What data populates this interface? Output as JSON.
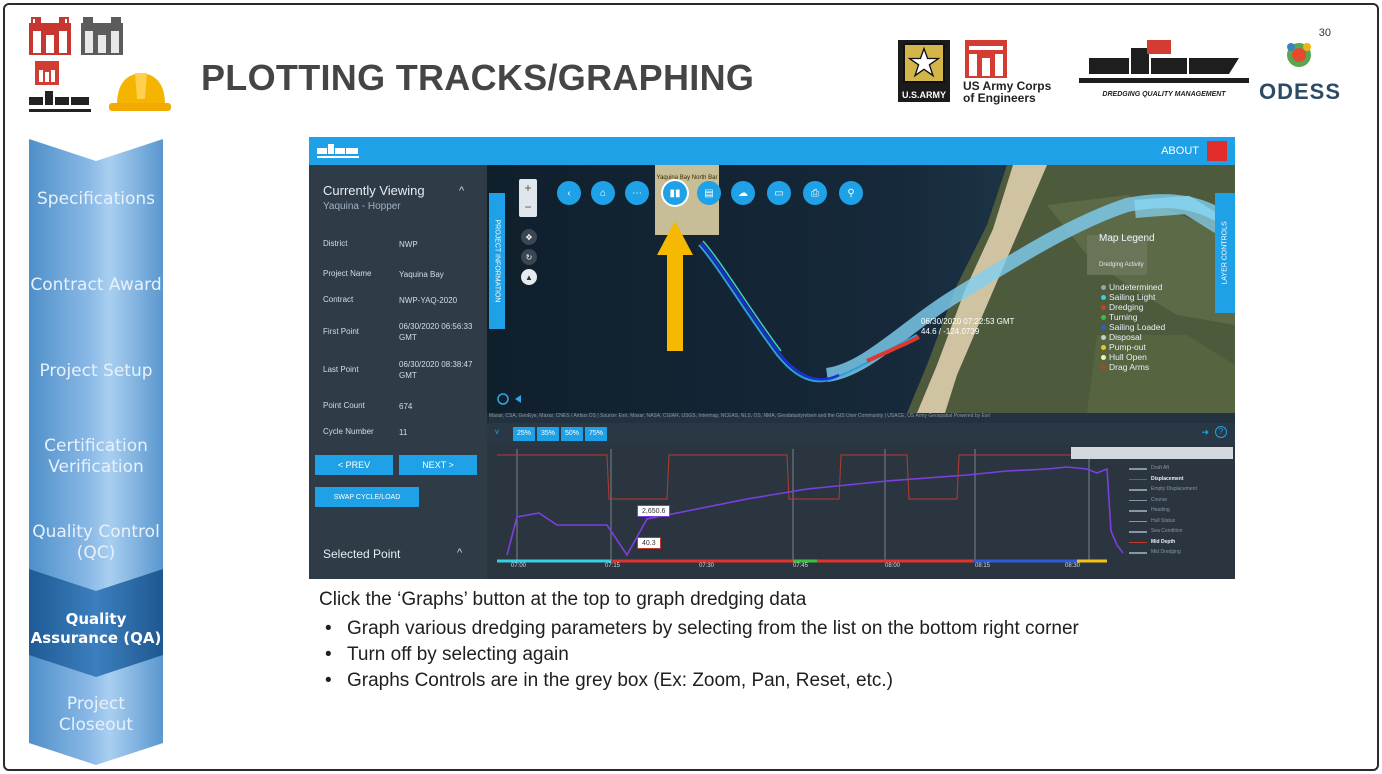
{
  "slide": {
    "number": "30",
    "title": "PLOTTING TRACKS/GRAPHING"
  },
  "logos": {
    "army_text": "U.S.ARMY",
    "usace_text_line1": "US Army Corps",
    "usace_text_line2": "of Engineers",
    "dqm_caption": "DREDGING QUALITY MANAGEMENT",
    "odess_text": "ODESS"
  },
  "nav": {
    "items": [
      {
        "label": "Specifications"
      },
      {
        "label": "Contract Award"
      },
      {
        "label": "Project Setup"
      },
      {
        "label": "Certification Verification"
      },
      {
        "label": "Quality Control (QC)"
      },
      {
        "label": "Quality Assurance (QA)",
        "active": true
      },
      {
        "label": "Project Closeout"
      }
    ]
  },
  "app": {
    "about": "ABOUT",
    "side_panel": {
      "title": "Currently Viewing",
      "subtitle": "Yaquina - Hopper",
      "rows": [
        {
          "key": "District",
          "value": "NWP"
        },
        {
          "key": "Project Name",
          "value": "Yaquina Bay"
        },
        {
          "key": "Contract",
          "value": "NWP-YAQ-2020"
        },
        {
          "key": "First Point",
          "value": "06/30/2020 06:56:33 GMT"
        },
        {
          "key": "Last Point",
          "value": "06/30/2020 08:38:47 GMT"
        },
        {
          "key": "Point Count",
          "value": "674"
        },
        {
          "key": "Cycle Number",
          "value": "11"
        }
      ],
      "prev": "< PREV",
      "next": "NEXT >",
      "swap": "SWAP CYCLE/LOAD",
      "selected_point": "Selected Point"
    },
    "project_tab": "PROJECT INFORMATION",
    "layer_tab": "LAYER CONTROLS",
    "map_label_top": "Yaquina Bay North Bar",
    "toolbar_icons": [
      "chevron-left-icon",
      "home-icon",
      "dots-icon",
      "graphs-icon",
      "document-icon",
      "cloud-download-icon",
      "ruler-icon",
      "print-icon",
      "location-pin-icon"
    ],
    "legend": {
      "title": "Map Legend",
      "subtitle": "Dredging Activity",
      "items": [
        {
          "label": "Undetermined",
          "color": "#9aa3ad"
        },
        {
          "label": "Sailing Light",
          "color": "#37d0e0"
        },
        {
          "label": "Dredging",
          "color": "#e0342c"
        },
        {
          "label": "Turning",
          "color": "#3fbf3f"
        },
        {
          "label": "Sailing Loaded",
          "color": "#2f5bd8"
        },
        {
          "label": "Disposal",
          "color": "#c9c9c9"
        },
        {
          "label": "Pump-out",
          "color": "#f2c318"
        },
        {
          "label": "Hull Open",
          "color": "#f4f4a0"
        },
        {
          "label": "Drag Arms",
          "color": "#c0392b"
        }
      ]
    },
    "hover_readout": {
      "line1": "06/30/2020 07:22:53 GMT",
      "line2": "44.6 / -124.0739"
    },
    "attribution": "Maxar, CSA, GeoEye, Maxar, CNES / Airbus DS | Source: Esri, Maxar, NASA, CGIAR, USGS, Intermap, NCEAS, NLS, OS, NMA, Geodatastyrelsen and the GIS User Community | USACE, US Army Geospatial    Powered by Esri",
    "graph_percents": [
      "25%",
      "35%",
      "50%",
      "75%"
    ],
    "graph": {
      "series_list": [
        {
          "label": "Draft Aft",
          "color": "#8797a5",
          "on": false
        },
        {
          "label": "Displacement",
          "color": "#7b3fe0",
          "on": true
        },
        {
          "label": "Empty Displacement",
          "color": "#8797a5",
          "on": false
        },
        {
          "label": "Course",
          "color": "#8797a5",
          "on": false
        },
        {
          "label": "Heading",
          "color": "#8797a5",
          "on": false
        },
        {
          "label": "Hull Status",
          "color": "#8797a5",
          "on": false
        },
        {
          "label": "Sea Condition",
          "color": "#8797a5",
          "on": false
        },
        {
          "label": "Mid Depth",
          "color": "#c0392b",
          "on": true
        },
        {
          "label": "Mid Dredging",
          "color": "#8797a5",
          "on": false
        }
      ],
      "time_ticks": [
        "07:00",
        "07:15",
        "07:30",
        "07:45",
        "08:00",
        "08:15",
        "08:30"
      ],
      "label_displacement": "2,650.6",
      "label_depth": "40.3"
    }
  },
  "instructions": {
    "caption": "Click the ‘Graphs’ button at the top to graph dredging data",
    "bullets": [
      "Graph various dredging parameters by selecting from the list on the bottom right corner",
      "Turn off by selecting again",
      "Graphs Controls are in the grey box (Ex: Zoom, Pan, Reset, etc.)"
    ]
  }
}
